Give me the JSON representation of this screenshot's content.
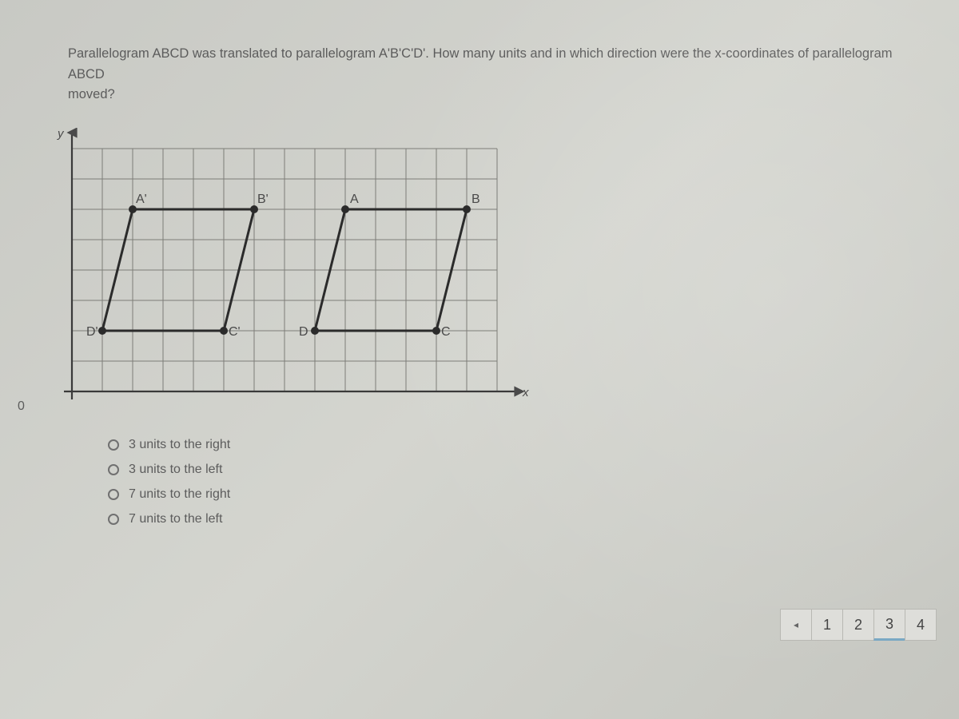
{
  "question": {
    "text_line1": "Parallelogram ABCD was translated to parallelogram A'B'C'D'.  How many units and in which direction were the x-coordinates of parallelogram ABCD",
    "text_line2": "moved?"
  },
  "axes": {
    "y_label": "y",
    "x_label": "x",
    "origin": "0"
  },
  "graph": {
    "labels": {
      "A_prime": "A'",
      "B_prime": "B'",
      "C_prime": "C'",
      "D_prime": "D'",
      "A": "A",
      "B": "B",
      "C": "C",
      "D": "D"
    }
  },
  "answers": [
    {
      "label": "3 units to the right"
    },
    {
      "label": "3 units to the left"
    },
    {
      "label": "7 units to the right"
    },
    {
      "label": "7 units to the left"
    }
  ],
  "pager": {
    "prev_glyph": "◂",
    "pages": [
      "1",
      "2",
      "3",
      "4"
    ],
    "current": "3"
  },
  "chart_data": {
    "type": "diagram",
    "description": "Coordinate grid (first quadrant) showing parallelogram ABCD and its translated image A'B'C'D'",
    "grid": {
      "x_range": [
        0,
        14
      ],
      "y_range": [
        0,
        8
      ],
      "step": 1
    },
    "original": {
      "A": [
        9,
        6
      ],
      "B": [
        13,
        6
      ],
      "C": [
        12,
        2
      ],
      "D": [
        8,
        2
      ]
    },
    "image": {
      "A'": [
        2,
        6
      ],
      "B'": [
        6,
        6
      ],
      "C'": [
        5,
        2
      ],
      "D'": [
        1,
        2
      ]
    },
    "translation": {
      "dx": -7,
      "dy": 0
    }
  }
}
